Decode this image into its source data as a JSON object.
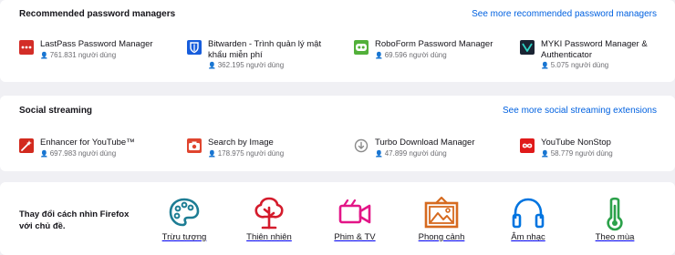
{
  "password_managers": {
    "title": "Recommended password managers",
    "see_more": "See more recommended password managers",
    "items": [
      {
        "name": "LastPass Password Manager",
        "users": "761.831 người dùng",
        "icon": "lastpass-icon",
        "color": "#d32d27"
      },
      {
        "name": "Bitwarden - Trình quản lý mật khẩu miễn phí",
        "users": "362.195 người dùng",
        "icon": "bitwarden-icon",
        "color": "#175ddc"
      },
      {
        "name": "RoboForm Password Manager",
        "users": "69.596 người dùng",
        "icon": "roboform-icon",
        "color": "#52b03a"
      },
      {
        "name": "MYKI Password Manager & Authenticator",
        "users": "5.075 người dùng",
        "icon": "myki-icon",
        "color": "#1a2433"
      }
    ]
  },
  "social_streaming": {
    "title": "Social streaming",
    "see_more": "See more social streaming extensions",
    "items": [
      {
        "name": "Enhancer for YouTube™",
        "users": "697.983 người dùng",
        "icon": "enhancer-youtube-icon",
        "color": "#d22a1e"
      },
      {
        "name": "Search by Image",
        "users": "178.975 người dùng",
        "icon": "camera-icon",
        "color": "#e0452f"
      },
      {
        "name": "Turbo Download Manager",
        "users": "47.899 người dùng",
        "icon": "download-icon",
        "color": "#8a8a8a"
      },
      {
        "name": "YouTube NonStop",
        "users": "58.779 người dùng",
        "icon": "infinity-icon",
        "color": "#e01a1a"
      }
    ]
  },
  "themes": {
    "intro": "Thay đổi cách nhìn Firefox với chủ đề.",
    "items": [
      {
        "label": "Trừu tượng",
        "icon": "palette-icon",
        "color": "#1d7d94"
      },
      {
        "label": "Thiên nhiên",
        "icon": "tree-icon",
        "color": "#d41b2c"
      },
      {
        "label": "Phim & TV",
        "icon": "video-camera-icon",
        "color": "#e31587"
      },
      {
        "label": "Phong cảnh",
        "icon": "landscape-frame-icon",
        "color": "#d66a1f"
      },
      {
        "label": "Âm nhạc",
        "icon": "headphones-icon",
        "color": "#0074e0"
      },
      {
        "label": "Theo mùa",
        "icon": "thermometer-icon",
        "color": "#2ba14a"
      }
    ]
  }
}
